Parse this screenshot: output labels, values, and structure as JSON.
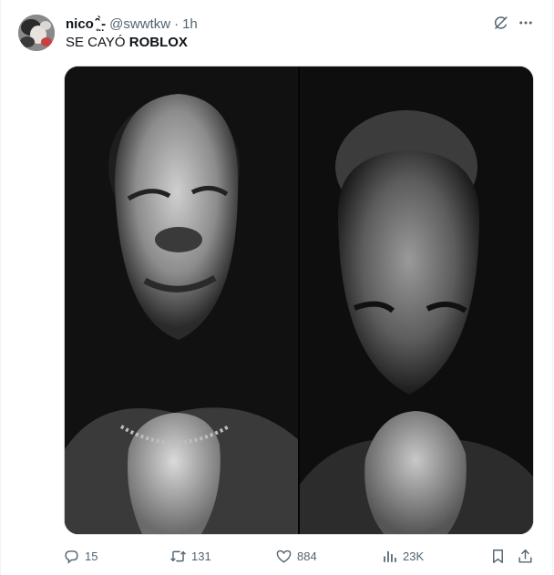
{
  "tweet": {
    "display_name": "nico ̥̑̂ ̤̀- ",
    "handle": "@swwtkw",
    "separator": "·",
    "time": "1h",
    "text_prefix": "SE CAYÓ ",
    "text_bold": "ROBLOX"
  },
  "media": {
    "description_left": "black-and-white photo of a man with closed eyes, hands clasped in prayer",
    "description_right": "black-and-white photo of an older man looking down, hands clasped in prayer"
  },
  "actions": {
    "replies": "15",
    "reposts": "131",
    "likes": "884",
    "views": "23K"
  },
  "icons": {
    "grok": "grok-icon",
    "more": "more-icon",
    "reply": "reply-icon",
    "repost": "repost-icon",
    "like": "like-icon",
    "views": "views-icon",
    "bookmark": "bookmark-icon",
    "share": "share-icon"
  }
}
